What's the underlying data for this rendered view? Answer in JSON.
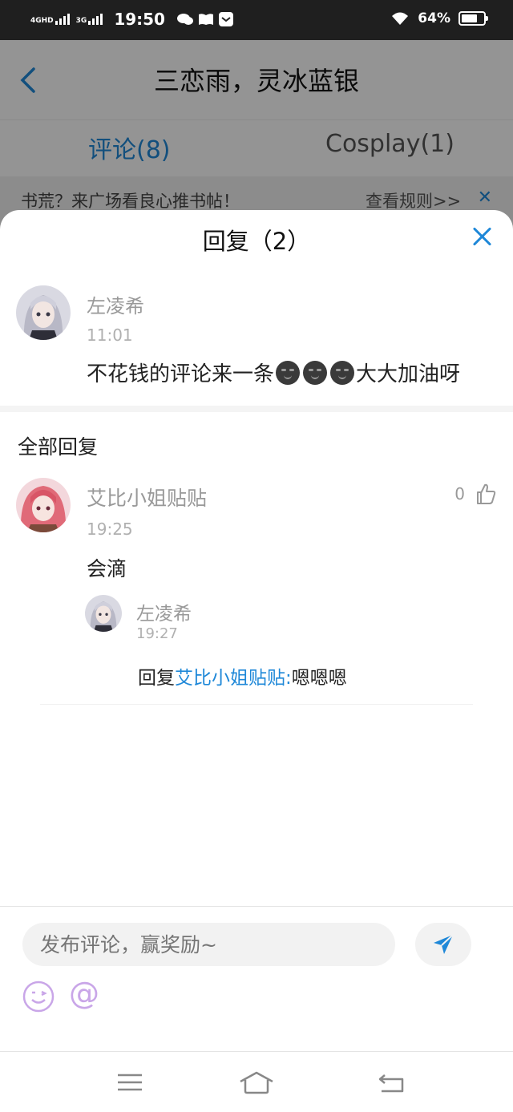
{
  "status_bar": {
    "network1": "4GHD",
    "network2": "3G",
    "time": "19:50",
    "battery": "64%",
    "battery_level": 0.64
  },
  "background_page": {
    "title": "三恋雨，灵冰蓝银",
    "tabs": [
      "评论(8)",
      "Cosplay(1)"
    ],
    "banner": {
      "text": "书荒？来广场看良心推书帖！",
      "rules": "查看规则>>",
      "close": "✕"
    }
  },
  "sheet": {
    "title": "回复（2）",
    "original": {
      "name": "左凌希",
      "time": "11:01",
      "text_before": "不花钱的评论来一条",
      "text_after": "大大加油呀",
      "emoji_count": 3
    },
    "section_title": "全部回复",
    "reply": {
      "name": "艾比小姐贴贴",
      "time": "19:25",
      "text": "会滴",
      "likes": "0",
      "nested": {
        "name": "左凌希",
        "time": "19:27",
        "prefix": "回复",
        "target": "艾比小姐贴贴:",
        "text": "嗯嗯嗯"
      }
    }
  },
  "composer": {
    "placeholder": "发布评论，赢奖励~",
    "at": "@"
  },
  "colors": {
    "accent": "#1f88d8",
    "muted": "#999999",
    "emoji_purple": "#c9a6e8"
  }
}
